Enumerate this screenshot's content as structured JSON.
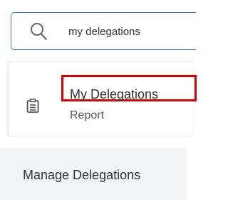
{
  "search": {
    "value": "my delegations",
    "icon": "search-icon"
  },
  "results": [
    {
      "title": "My Delegations",
      "subtitle": "Report",
      "icon": "report-icon"
    }
  ],
  "menu": {
    "manage_delegations_label": "Manage Delegations"
  },
  "colors": {
    "focus_border": "#2f7bd6",
    "highlight": "#e00000",
    "menu_background": "#f2f3f4"
  }
}
